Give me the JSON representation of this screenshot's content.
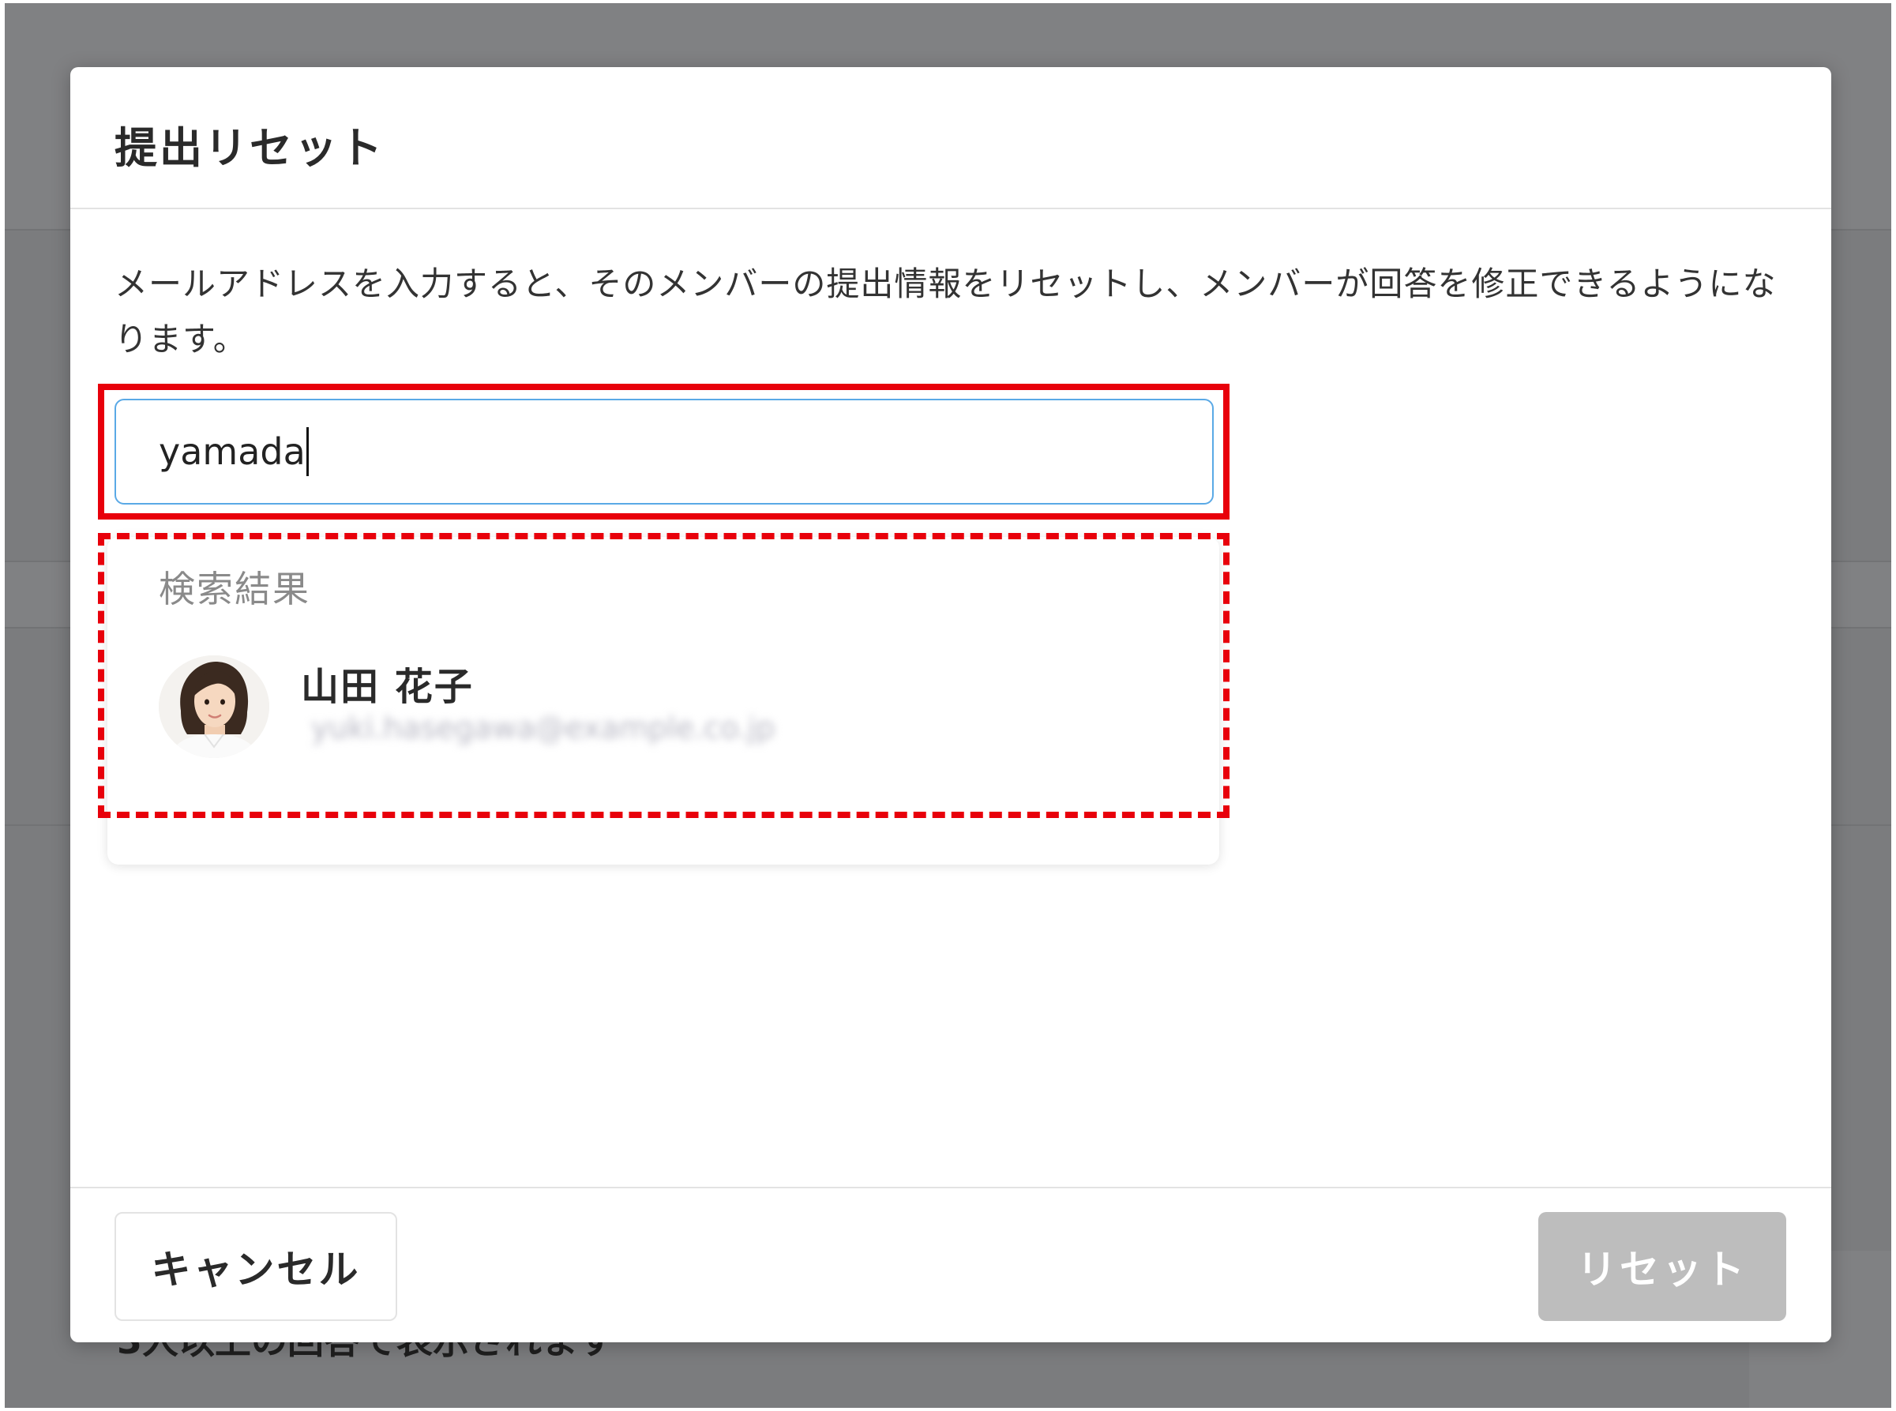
{
  "background": {
    "bottom_text": "3人以上の回答で表示されます"
  },
  "dialog": {
    "title": "提出リセット",
    "description": "メールアドレスを入力すると、そのメンバーの提出情報をリセットし、メンバーが回答を修正できるようになります。",
    "search": {
      "value": "yamada"
    },
    "results": {
      "heading": "検索結果",
      "items": [
        {
          "name": "山田 花子",
          "email": "yuki.hasegawa@example.co.jp",
          "avatar": "person-photo"
        }
      ]
    },
    "footer": {
      "cancel_label": "キャンセル",
      "reset_label": "リセット",
      "reset_disabled": true
    }
  },
  "annotations": {
    "highlight_color": "#e8000b"
  }
}
